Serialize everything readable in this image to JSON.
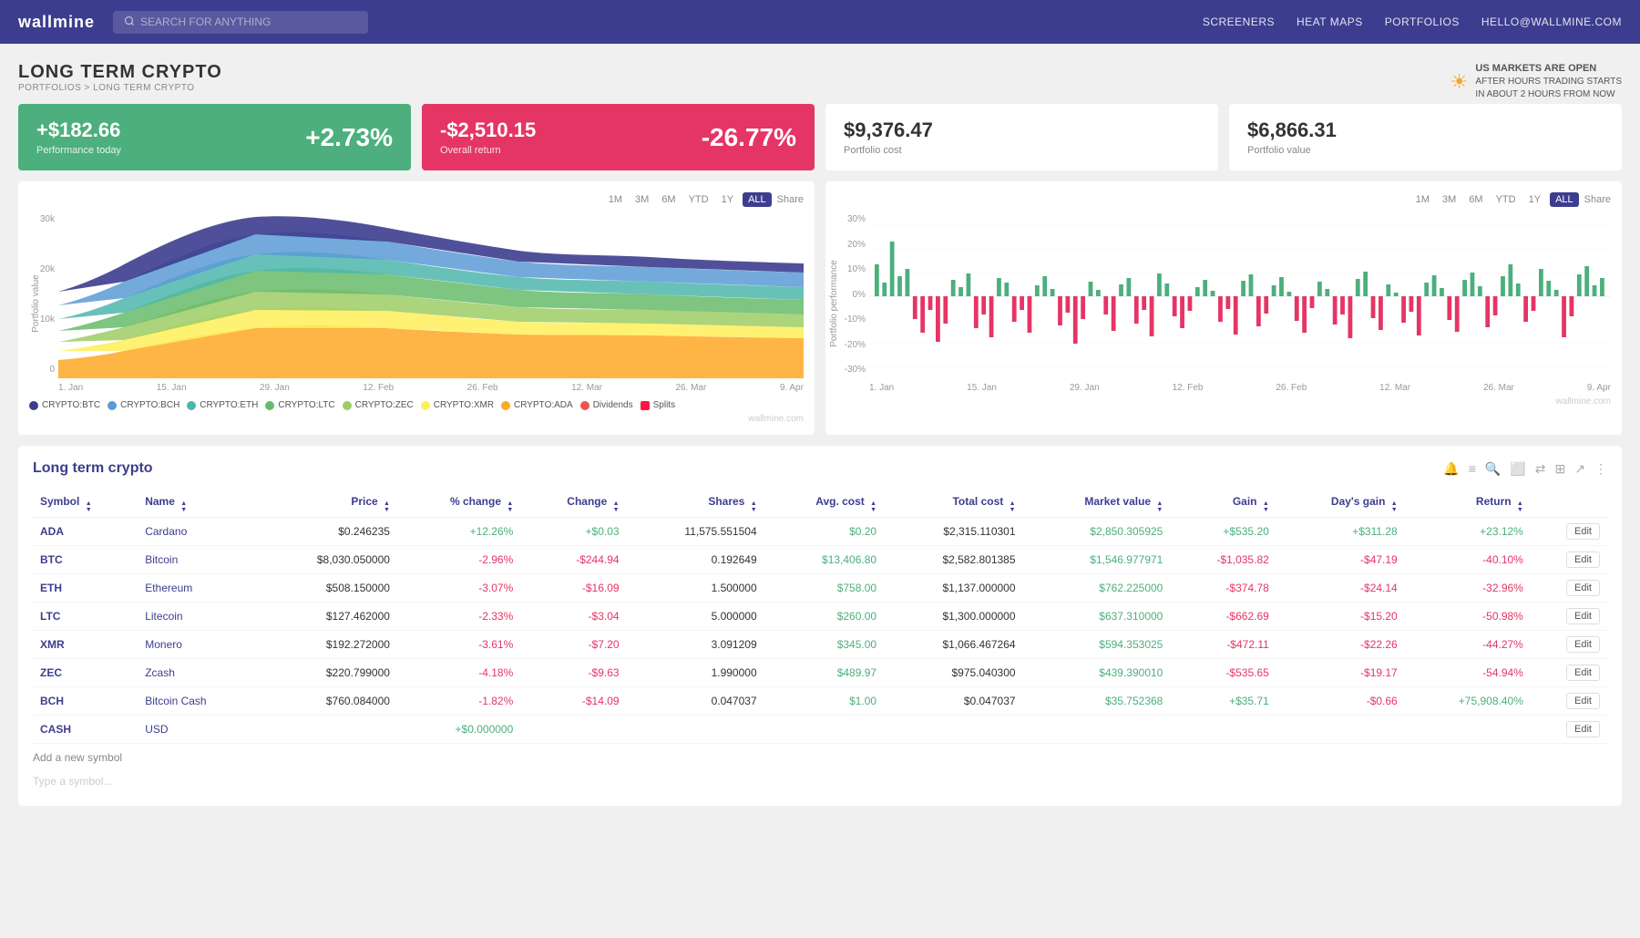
{
  "header": {
    "logo": "wallmine",
    "search_placeholder": "SEARCH FOR ANYTHING",
    "nav": [
      "SCREENERS",
      "HEAT MAPS",
      "PORTFOLIOS",
      "HELLO@WALLMINE.COM"
    ]
  },
  "breadcrumb": {
    "page_title": "LONG TERM CRYPTO",
    "path": "PORTFOLIOS > LONG TERM CRYPTO"
  },
  "market_status": {
    "line1": "US MARKETS ARE OPEN",
    "line2": "AFTER HOURS TRADING STARTS",
    "line3": "IN ABOUT 2 HOURS FROM NOW"
  },
  "cards": {
    "performance": {
      "value": "+$182.66",
      "label": "Performance today",
      "pct": "+2.73%"
    },
    "overall": {
      "value": "-$2,510.15",
      "label": "Overall return",
      "pct": "-26.77%"
    },
    "portfolio_cost": {
      "value": "$9,376.47",
      "label": "Portfolio cost"
    },
    "portfolio_value": {
      "value": "$6,866.31",
      "label": "Portfolio value"
    }
  },
  "chart_left": {
    "time_buttons": [
      "1M",
      "3M",
      "6M",
      "YTD",
      "1Y",
      "ALL"
    ],
    "active": "ALL",
    "share": "Share",
    "y_labels": [
      "30k",
      "20k",
      "10k",
      "0"
    ],
    "x_labels": [
      "1. Jan",
      "15. Jan",
      "29. Jan",
      "12. Feb",
      "26. Feb",
      "12. Mar",
      "26. Mar",
      "9. Apr"
    ],
    "legend": [
      {
        "label": "CRYPTO:BTC",
        "color": "#3d3d8f"
      },
      {
        "label": "CRYPTO:BCH",
        "color": "#5b9bd5"
      },
      {
        "label": "CRYPTO:ETH",
        "color": "#4db6ac"
      },
      {
        "label": "CRYPTO:LTC",
        "color": "#66bb6a"
      },
      {
        "label": "CRYPTO:ZEC",
        "color": "#9ccc65"
      },
      {
        "label": "CRYPTO:XMR",
        "color": "#ffee58"
      },
      {
        "label": "CRYPTO:ADA",
        "color": "#ffa726"
      },
      {
        "label": "Dividends",
        "color": "#ef5350"
      },
      {
        "label": "Splits",
        "color": "#ff1744"
      }
    ],
    "watermark": "wallmine.com"
  },
  "chart_right": {
    "time_buttons": [
      "1M",
      "3M",
      "6M",
      "YTD",
      "1Y",
      "ALL"
    ],
    "active": "ALL",
    "share": "Share",
    "y_labels": [
      "30%",
      "20%",
      "10%",
      "0%",
      "-10%",
      "-20%",
      "-30%"
    ],
    "x_labels": [
      "1. Jan",
      "15. Jan",
      "29. Jan",
      "12. Feb",
      "26. Feb",
      "12. Mar",
      "26. Mar",
      "9. Apr"
    ],
    "y_axis_label": "Portfolio performance",
    "watermark": "wallmine.com"
  },
  "table": {
    "title": "Long term crypto",
    "columns": [
      "Symbol",
      "Name",
      "Price",
      "% change",
      "Change",
      "Shares",
      "Avg. cost",
      "Total cost",
      "Market value",
      "Gain",
      "Day's gain",
      "Return",
      ""
    ],
    "rows": [
      {
        "symbol": "ADA",
        "name": "Cardano",
        "price": "$0.246235",
        "pct_change": "+12.26%",
        "change": "+$0.03",
        "shares": "11,575.551504",
        "avg_cost": "$0.20",
        "total_cost": "$2,315.110301",
        "market_value": "$2,850.305925",
        "gain": "+$535.20",
        "days_gain": "+$311.28",
        "return": "+23.12%",
        "has_edit": true
      },
      {
        "symbol": "BTC",
        "name": "Bitcoin",
        "price": "$8,030.050000",
        "pct_change": "-2.96%",
        "change": "-$244.94",
        "shares": "0.192649",
        "avg_cost": "$13,406.80",
        "total_cost": "$2,582.801385",
        "market_value": "$1,546.977971",
        "gain": "-$1,035.82",
        "days_gain": "-$47.19",
        "return": "-40.10%",
        "has_edit": true
      },
      {
        "symbol": "ETH",
        "name": "Ethereum",
        "price": "$508.150000",
        "pct_change": "-3.07%",
        "change": "-$16.09",
        "shares": "1.500000",
        "avg_cost": "$758.00",
        "total_cost": "$1,137.000000",
        "market_value": "$762.225000",
        "gain": "-$374.78",
        "days_gain": "-$24.14",
        "return": "-32.96%",
        "has_edit": true
      },
      {
        "symbol": "LTC",
        "name": "Litecoin",
        "price": "$127.462000",
        "pct_change": "-2.33%",
        "change": "-$3.04",
        "shares": "5.000000",
        "avg_cost": "$260.00",
        "total_cost": "$1,300.000000",
        "market_value": "$637.310000",
        "gain": "-$662.69",
        "days_gain": "-$15.20",
        "return": "-50.98%",
        "has_edit": true
      },
      {
        "symbol": "XMR",
        "name": "Monero",
        "price": "$192.272000",
        "pct_change": "-3.61%",
        "change": "-$7.20",
        "shares": "3.091209",
        "avg_cost": "$345.00",
        "total_cost": "$1,066.467264",
        "market_value": "$594.353025",
        "gain": "-$472.11",
        "days_gain": "-$22.26",
        "return": "-44.27%",
        "has_edit": true
      },
      {
        "symbol": "ZEC",
        "name": "Zcash",
        "price": "$220.799000",
        "pct_change": "-4.18%",
        "change": "-$9.63",
        "shares": "1.990000",
        "avg_cost": "$489.97",
        "total_cost": "$975.040300",
        "market_value": "$439.390010",
        "gain": "-$535.65",
        "days_gain": "-$19.17",
        "return": "-54.94%",
        "has_edit": true
      },
      {
        "symbol": "BCH",
        "name": "Bitcoin Cash",
        "price": "$760.084000",
        "pct_change": "-1.82%",
        "change": "-$14.09",
        "shares": "0.047037",
        "avg_cost": "$1.00",
        "total_cost": "$0.047037",
        "market_value": "$35.752368",
        "gain": "+$35.71",
        "days_gain": "-$0.66",
        "return": "+75,908.40%",
        "has_edit": true
      },
      {
        "symbol": "CASH",
        "name": "USD",
        "price": "",
        "pct_change": "+$0.000000",
        "change": "",
        "shares": "",
        "avg_cost": "",
        "total_cost": "",
        "market_value": "",
        "gain": "",
        "days_gain": "",
        "return": "",
        "has_edit": true
      }
    ],
    "add_symbol": "Add a new symbol",
    "type_symbol": "Type a symbol..."
  }
}
